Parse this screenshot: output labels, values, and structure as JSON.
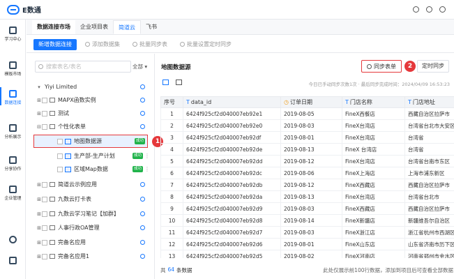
{
  "app": {
    "name": "E数通"
  },
  "nav": [
    {
      "label": "学习中心",
      "icon": "book-icon"
    },
    {
      "label": "模板市场",
      "icon": "template-icon"
    },
    {
      "label": "数据连接",
      "icon": "data-connection-icon",
      "active": true
    },
    {
      "label": "分析展示",
      "icon": "analysis-icon"
    },
    {
      "label": "分享协作",
      "icon": "share-icon"
    },
    {
      "label": "企业管理",
      "icon": "enterprise-icon"
    }
  ],
  "tabs": [
    {
      "label": "数据连接市场"
    },
    {
      "label": "企业项目表"
    },
    {
      "label": "简道云",
      "active": true
    },
    {
      "label": "飞书"
    }
  ],
  "toolbar": {
    "add_connection": "新增数据连接",
    "add_dataset": "添加数据集",
    "batch_sync": "批量同步表",
    "batch_schedule": "批量设置定时同步"
  },
  "tree": {
    "search_placeholder": "搜索表名/表名",
    "filter_label": "全部",
    "rows": [
      {
        "label": "Yiyi Limited",
        "level": 0,
        "type": "root"
      },
      {
        "label": "MAPX函数实例",
        "level": 1,
        "type": "folder"
      },
      {
        "label": "测试",
        "level": 1,
        "type": "folder"
      },
      {
        "label": "个性化表单",
        "level": 1,
        "type": "folder"
      },
      {
        "label": "地图数据源",
        "level": 2,
        "type": "table",
        "badge": "成功",
        "selected": true
      },
      {
        "label": "生产部-生产计划",
        "level": 2,
        "type": "table",
        "badge": "成功"
      },
      {
        "label": "区域Map数据",
        "level": 2,
        "type": "table",
        "badge": "成功"
      },
      {
        "label": "简道云示例应用",
        "level": 1,
        "type": "folder"
      },
      {
        "label": "九数云打卡表",
        "level": 1,
        "type": "folder"
      },
      {
        "label": "九数云学习笔记【加群】",
        "level": 1,
        "type": "folder"
      },
      {
        "label": "人事行政OA管理",
        "level": 1,
        "type": "folder"
      },
      {
        "label": "完备名应用",
        "level": 1,
        "type": "folder"
      },
      {
        "label": "完备名应用1",
        "level": 1,
        "type": "folder"
      }
    ]
  },
  "main": {
    "title": "地图数据源",
    "sync_button": "同步表单",
    "schedule_button": "定时同步",
    "sync_info": "今日已手动同步次数1次 · 最后同步完成时间：2024/04/09 16:53:23",
    "columns": [
      "序号",
      "data_id",
      "订单日期",
      "门店名称",
      "门店地址"
    ],
    "rows": [
      [
        "1",
        "6424f925cf2d040007eb92e1",
        "2019-08-05",
        "FineX西餐店",
        "西藏自治区拉萨市"
      ],
      [
        "2",
        "6424f925cf2d040007eb92e0",
        "2019-08-03",
        "FineX台湾店",
        "台湾省台北市大安区"
      ],
      [
        "3",
        "6424f925cf2d040007eb92df",
        "2019-08-01",
        "FineX台湾店",
        "台湾省"
      ],
      [
        "4",
        "6424f925cf2d040007eb92de",
        "2019-08-13",
        "FineX 台湾店",
        "台湾省"
      ],
      [
        "5",
        "6424f925cf2d040007eb92dd",
        "2019-08-12",
        "FineX台湾店",
        "台湾省台南市东区"
      ],
      [
        "6",
        "6424f925cf2d040007eb92dc",
        "2019-08-06",
        "FineX上海店",
        "上海市浦东新区"
      ],
      [
        "7",
        "6424f925cf2d040007eb92db",
        "2019-08-12",
        "FineX西藏店",
        "西藏自治区拉萨市"
      ],
      [
        "8",
        "6424f925cf2d040007eb92da",
        "2019-08-13",
        "FineX台湾店",
        "台湾省台北市"
      ],
      [
        "9",
        "6424f925cf2d040007eb92d9",
        "2019-08-03",
        "FineX西藏店",
        "西藏自治区拉萨市"
      ],
      [
        "10",
        "6424f925cf2d040007eb92d8",
        "2019-08-14",
        "FineX新疆店",
        "新疆维吾尔自治区"
      ],
      [
        "11",
        "6424f925cf2d040007eb92d7",
        "2019-08-03",
        "FineX浙江店",
        "浙江省杭州市西湖区"
      ],
      [
        "12",
        "6424f925cf2d040007eb92d6",
        "2019-08-01",
        "FineX山东店",
        "山东省济南市历下区"
      ],
      [
        "13",
        "6424f925cf2d040007eb92d5",
        "2019-08-02",
        "FineX河南店",
        "河南省郑州市金水区"
      ]
    ],
    "footer_prefix": "共",
    "footer_count": "64",
    "footer_suffix": "条数据",
    "footer_tip": "此处仅展示前100行数据，添加到项目后可查看全部数据"
  },
  "callouts": {
    "one": "1",
    "two": "2"
  },
  "colors": {
    "accent": "#1677ff",
    "highlight": "#e5383b",
    "success": "#21b34b"
  }
}
